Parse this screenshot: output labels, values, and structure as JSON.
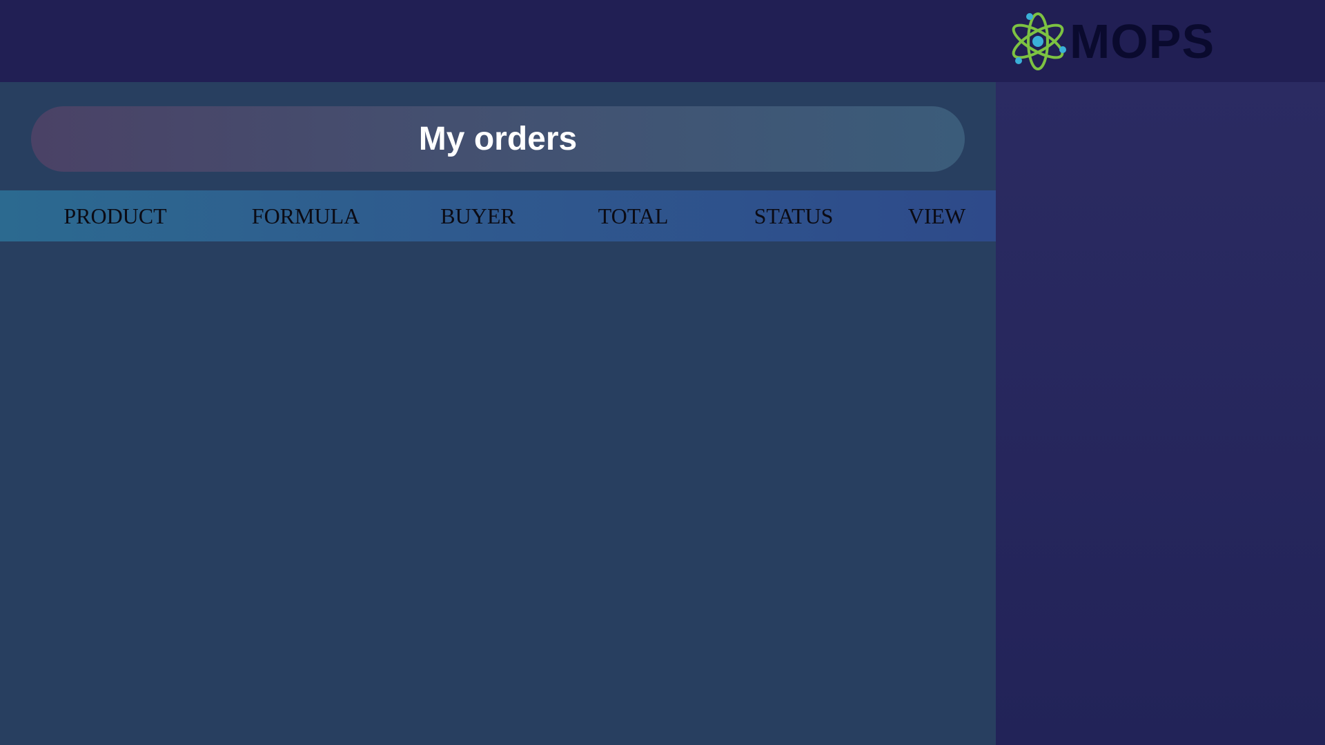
{
  "brand": {
    "name": "MOPS",
    "icon": "atom-icon",
    "colors": {
      "orbit": "#7dc242",
      "nucleus": "#3ab0d8",
      "text": "#0a0a2e"
    }
  },
  "page": {
    "title": "My orders"
  },
  "orders_table": {
    "columns": [
      "PRODUCT",
      "FORMULA",
      "BUYER",
      "TOTAL",
      "STATUS",
      "VIEW"
    ],
    "rows": []
  },
  "colors": {
    "topbar": "#211f54",
    "main_bg": "#283f60",
    "sidebar": "#25255c"
  }
}
